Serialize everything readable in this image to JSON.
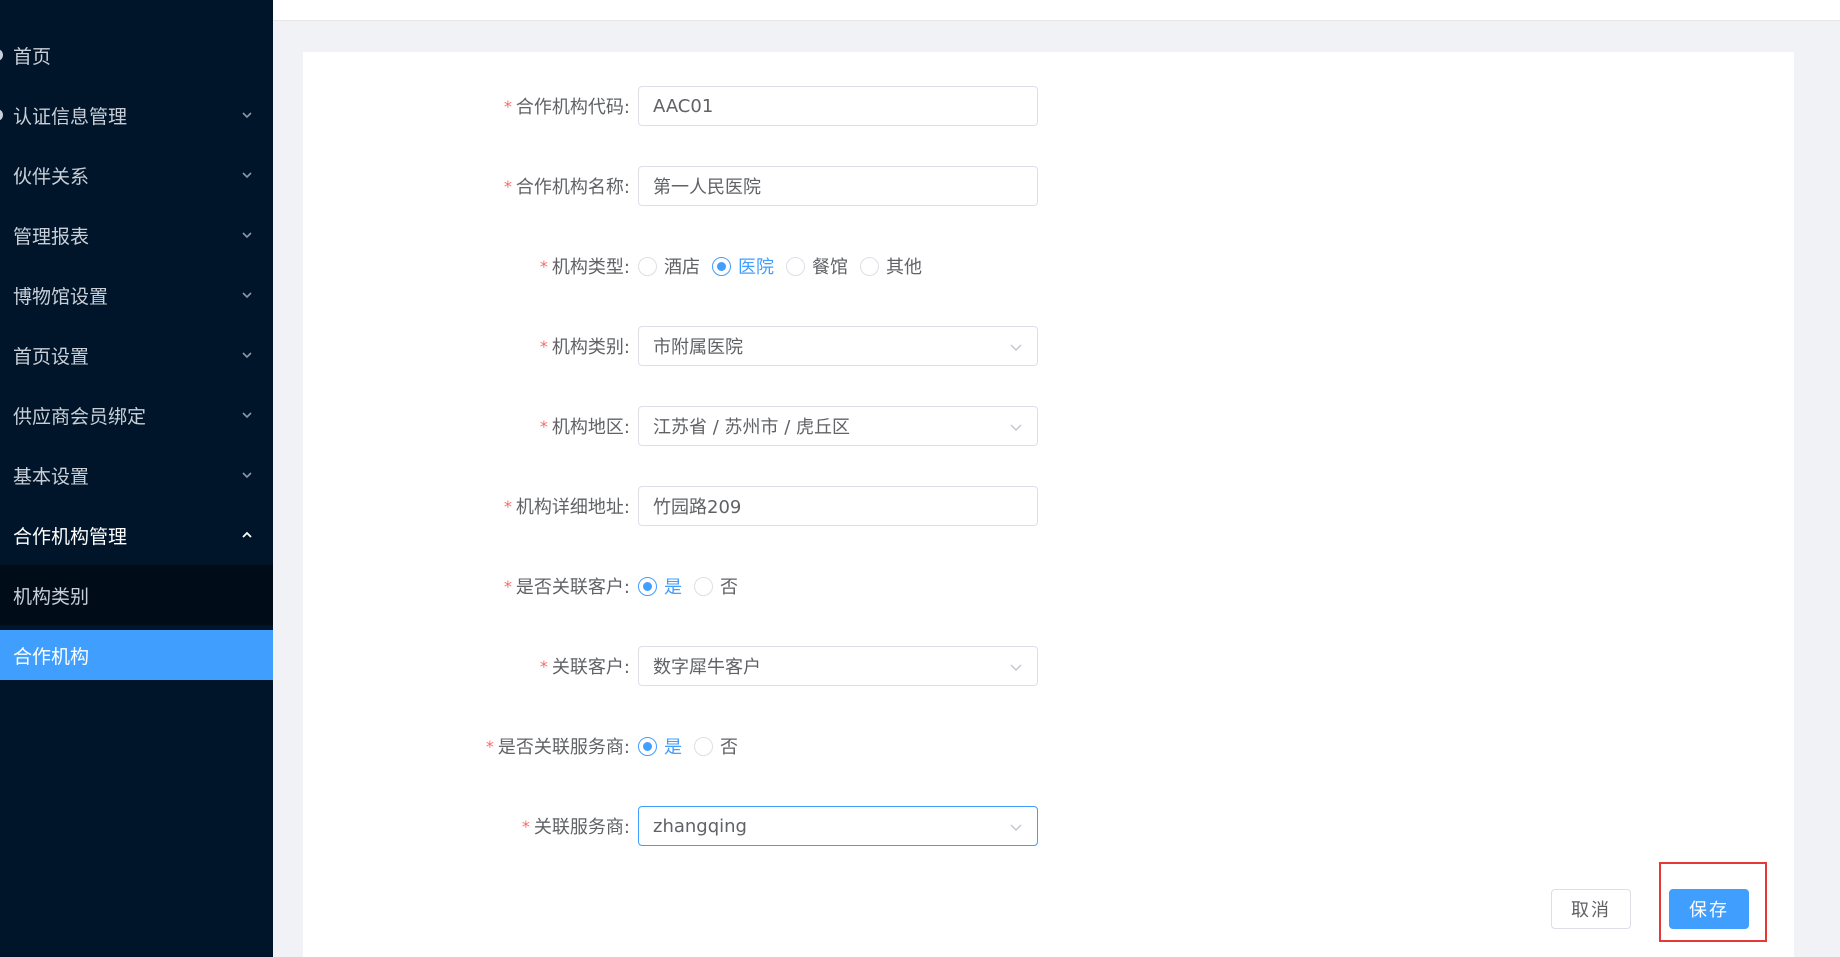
{
  "sidebar": {
    "items": [
      {
        "label": "首页"
      },
      {
        "label": "认证信息管理"
      },
      {
        "label": "伙伴关系"
      },
      {
        "label": "管理报表"
      },
      {
        "label": "博物馆设置"
      },
      {
        "label": "首页设置"
      },
      {
        "label": "供应商会员绑定"
      },
      {
        "label": "基本设置"
      },
      {
        "label": "合作机构管理"
      }
    ],
    "subitems": [
      {
        "label": "机构类别"
      },
      {
        "label": "合作机构"
      }
    ]
  },
  "form": {
    "code": {
      "label": "合作机构代码:",
      "value": "AAC01"
    },
    "name": {
      "label": "合作机构名称:",
      "value": "第一人民医院"
    },
    "type": {
      "label": "机构类型:",
      "options": [
        "酒店",
        "医院",
        "餐馆",
        "其他"
      ],
      "selected": "医院"
    },
    "category": {
      "label": "机构类别:",
      "value": "市附属医院"
    },
    "region": {
      "label": "机构地区:",
      "value": "江苏省 / 苏州市 / 虎丘区"
    },
    "address": {
      "label": "机构详细地址:",
      "value": "竹园路209"
    },
    "link_customer": {
      "label": "是否关联客户:",
      "options": [
        "是",
        "否"
      ],
      "selected": "是"
    },
    "customer": {
      "label": "关联客户:",
      "value": "数字犀牛客户"
    },
    "link_provider": {
      "label": "是否关联服务商:",
      "options": [
        "是",
        "否"
      ],
      "selected": "是"
    },
    "provider": {
      "label": "关联服务商:",
      "value": "zhangqing"
    },
    "required_mark": "*"
  },
  "actions": {
    "cancel_label": "取消",
    "save_label": "保存"
  },
  "colors": {
    "sidebar_bg": "#001529",
    "accent": "#409eff",
    "required": "#f56c6c",
    "highlight": "#e53935"
  }
}
